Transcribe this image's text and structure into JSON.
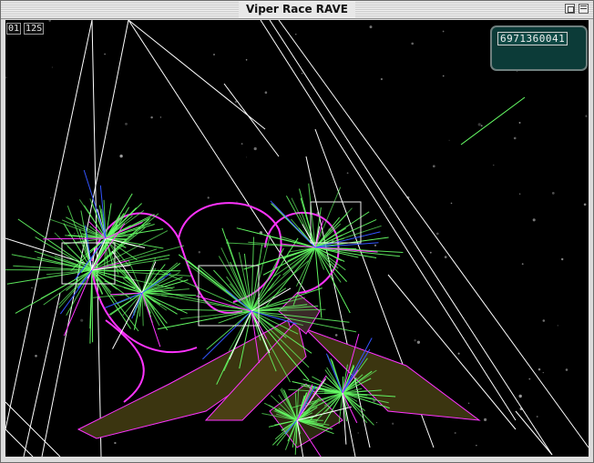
{
  "window": {
    "title": "Viper Race RAVE"
  },
  "hud": {
    "lap": "01",
    "time": "12S",
    "score": "6971360041"
  },
  "icons": {
    "zoom": "zoom-box-icon",
    "collapse": "windowshade-icon"
  },
  "colors": {
    "background": "#000000",
    "wire_white": "#ffffff",
    "wire_green": "#66ff66",
    "wire_magenta": "#ff33ff",
    "wire_blue": "#3355ff",
    "hull_olive": "#3b3510",
    "hud_panel": "#0c3b38"
  }
}
